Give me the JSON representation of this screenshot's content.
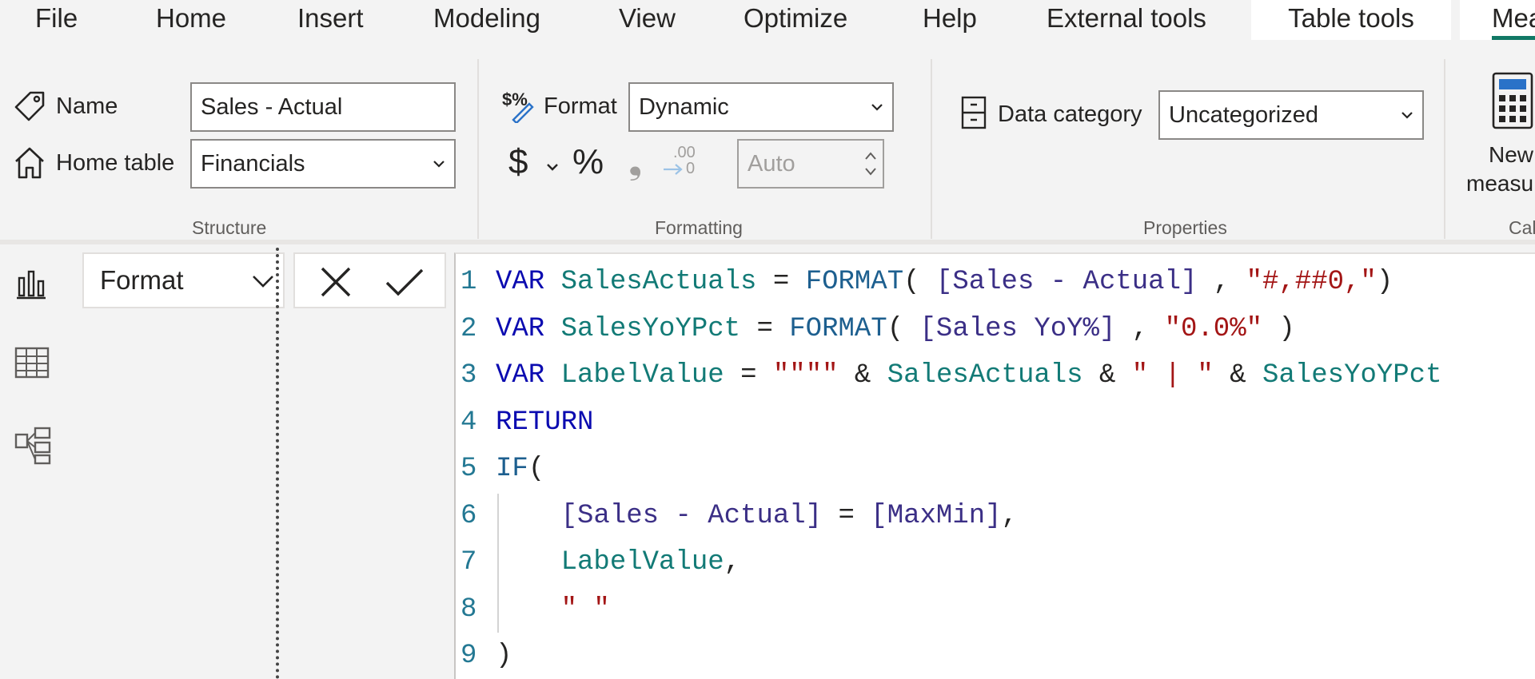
{
  "menu": {
    "items": [
      "File",
      "Home",
      "Insert",
      "Modeling",
      "View",
      "Optimize",
      "Help",
      "External tools",
      "Table tools",
      "Mea"
    ],
    "active": "Table tools"
  },
  "ribbon": {
    "structure": {
      "name_label": "Name",
      "name_value": "Sales - Actual",
      "home_table_label": "Home table",
      "home_table_value": "Financials",
      "group_label": "Structure"
    },
    "formatting": {
      "format_label": "Format",
      "format_value": "Dynamic",
      "currency_symbol": "$",
      "percent_symbol": "%",
      "comma_symbol": "❟",
      "decimal_top": ".00",
      "decimal_bottom": "0",
      "decimals_placeholder": "Auto",
      "group_label": "Formatting"
    },
    "properties": {
      "data_category_label": "Data category",
      "data_category_value": "Uncategorized",
      "group_label": "Properties"
    },
    "calculations": {
      "new_measure_line1": "New",
      "new_measure_line2": "measu",
      "group_label": "Cal"
    }
  },
  "formula_bar": {
    "property_dropdown": "Format"
  },
  "editor": {
    "lines": [
      {
        "n": "1",
        "tokens": [
          [
            "kw",
            "VAR "
          ],
          [
            "var",
            "SalesActuals"
          ],
          [
            "op",
            " = "
          ],
          [
            "fn",
            "FORMAT"
          ],
          [
            "op",
            "( "
          ],
          [
            "col",
            "[Sales - Actual]"
          ],
          [
            "op",
            " , "
          ],
          [
            "str",
            "\"#,##0,\""
          ],
          [
            "op",
            ")"
          ]
        ]
      },
      {
        "n": "2",
        "tokens": [
          [
            "kw",
            "VAR "
          ],
          [
            "var",
            "SalesYoYPct"
          ],
          [
            "op",
            " = "
          ],
          [
            "fn",
            "FORMAT"
          ],
          [
            "op",
            "( "
          ],
          [
            "col",
            "[Sales YoY%]"
          ],
          [
            "op",
            " , "
          ],
          [
            "str",
            "\"0.0%\""
          ],
          [
            "op",
            " )"
          ]
        ]
      },
      {
        "n": "3",
        "tokens": [
          [
            "kw",
            "VAR "
          ],
          [
            "var",
            "LabelValue"
          ],
          [
            "op",
            " = "
          ],
          [
            "str",
            "\"\"\"\""
          ],
          [
            "op",
            " & "
          ],
          [
            "var",
            "SalesActuals"
          ],
          [
            "op",
            " & "
          ],
          [
            "str",
            "\" | \""
          ],
          [
            "op",
            " & "
          ],
          [
            "var",
            "SalesYoYPct"
          ]
        ]
      },
      {
        "n": "4",
        "tokens": [
          [
            "kw",
            "RETURN"
          ]
        ]
      },
      {
        "n": "5",
        "tokens": [
          [
            "fn",
            "IF"
          ],
          [
            "op",
            "("
          ]
        ]
      },
      {
        "n": "6",
        "tokens": [
          [
            "op",
            "    "
          ],
          [
            "col",
            "[Sales - Actual]"
          ],
          [
            "op",
            " = "
          ],
          [
            "col",
            "[MaxMin]"
          ],
          [
            "op",
            ","
          ]
        ]
      },
      {
        "n": "7",
        "tokens": [
          [
            "op",
            "    "
          ],
          [
            "var",
            "LabelValue"
          ],
          [
            "op",
            ","
          ]
        ]
      },
      {
        "n": "8",
        "tokens": [
          [
            "op",
            "    "
          ],
          [
            "str",
            "\" \""
          ]
        ]
      },
      {
        "n": "9",
        "tokens": [
          [
            "op",
            ")"
          ]
        ]
      }
    ]
  }
}
